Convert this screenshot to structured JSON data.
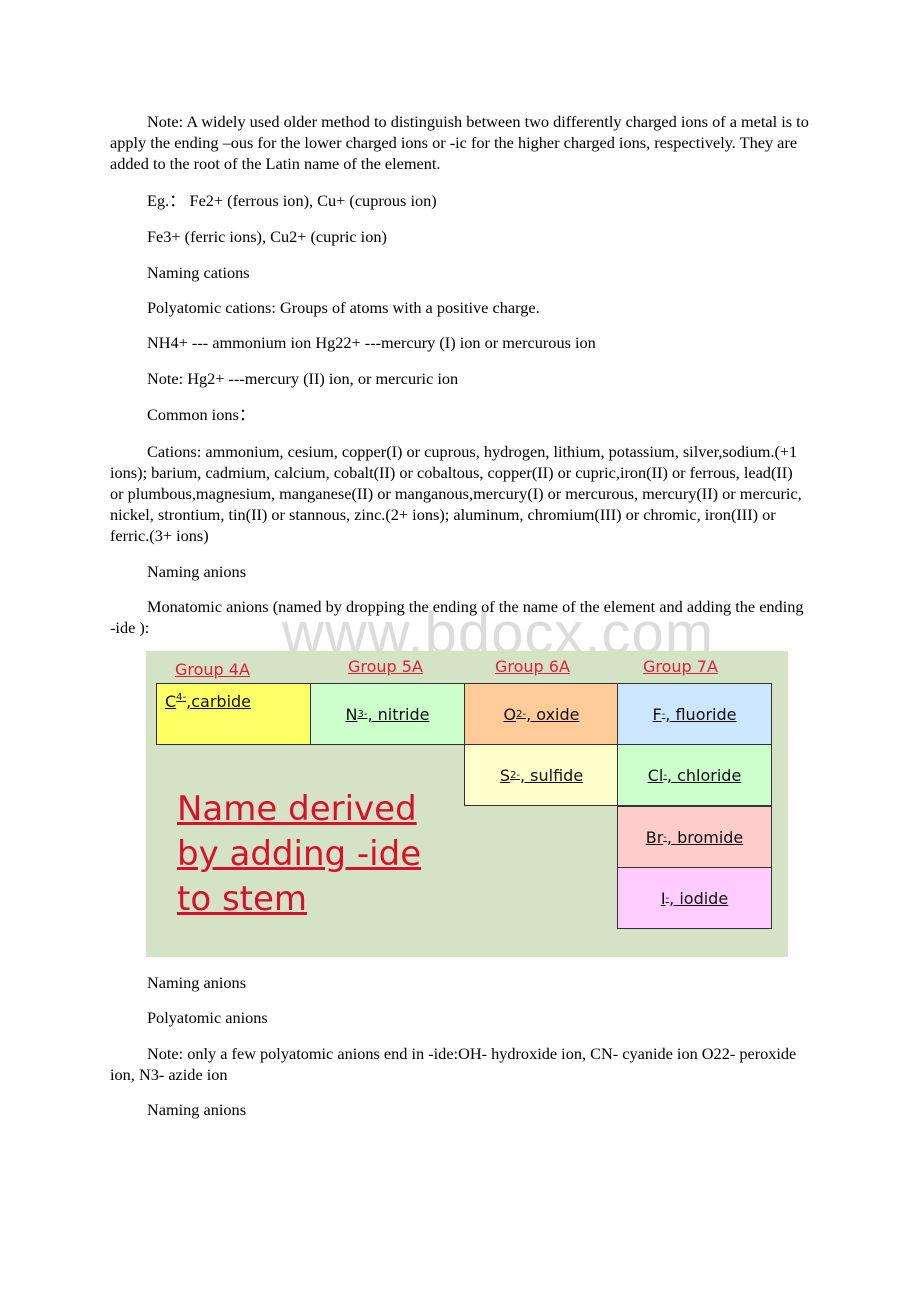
{
  "document": {
    "paragraphs": {
      "note_older_method": "Note: A widely used older method to distinguish between two differently charged ions of a metal is to apply the ending –ous for the lower charged ions or -ic for the higher charged ions, respectively. They are added to the root of the Latin name of the element.",
      "eg_line1": "Eg.： Fe2+ (ferrous ion), Cu+ (cuprous ion)",
      "eg_line2": " Fe3+ (ferric ions), Cu2+ (cupric ion)",
      "naming_cations": "Naming cations",
      "polyatomic_cations": "Polyatomic cations: Groups of atoms with a positive charge.",
      "nh4_line": "NH4+ --- ammonium ion Hg22+ ---mercury (I) ion or mercurous ion",
      "hg_note": "Note: Hg2+ ---mercury (II) ion, or mercuric ion",
      "common_ions": "Common ions：",
      "cations_list": "Cations: ammonium, cesium, copper(I) or cuprous, hydrogen, lithium, potassium, silver,sodium.(+1 ions); barium, cadmium, calcium, cobalt(II) or cobaltous, copper(II) or cupric,iron(II) or ferrous, lead(II) or plumbous,magnesium, manganese(II) or manganous,mercury(I) or mercurous, mercury(II) or mercuric, nickel, strontium, tin(II) or stannous, zinc.(2+ ions); aluminum, chromium(III) or chromic, iron(III) or ferric.(3+ ions)",
      "naming_anions_1": "Naming anions",
      "monatomic_anions": " Monatomic anions (named by dropping the ending of the name of the element and adding the ending -ide ):",
      "naming_anions_2": "Naming anions",
      "polyatomic_anions": "Polyatomic anions",
      "ide_note": "Note: only a few polyatomic anions end in -ide:OH- hydroxide ion, CN- cyanide ion O22- peroxide ion, N3- azide ion",
      "naming_anions_3": "Naming anions"
    },
    "watermark": "www.bdocx.com",
    "figure": {
      "groups": [
        "Group 4A",
        "Group 5A",
        "Group 6A",
        "Group 7A"
      ],
      "cells": [
        {
          "symbol": "C",
          "charge": "4-",
          "name": ",carbide",
          "color": "#ffff66"
        },
        {
          "symbol": "N",
          "charge": "3-",
          "name": ", nitride",
          "color": "#ccffcc"
        },
        {
          "symbol": "O",
          "charge": "2-",
          "name": ", oxide",
          "color": "#ffcc99"
        },
        {
          "symbol": "F",
          "charge": "-",
          "name": ", fluoride",
          "color": "#cce6ff"
        },
        {
          "symbol": "S",
          "charge": "2-",
          "name": ", sulfide",
          "color": "#ffffcc"
        },
        {
          "symbol": "Cl",
          "charge": "-",
          "name": ", chloride",
          "color": "#ccffcc"
        },
        {
          "symbol": "Br",
          "charge": "-",
          "name": ", bromide",
          "color": "#ffcccc"
        },
        {
          "symbol": "I",
          "charge": "-",
          "name": ", iodide",
          "color": "#ffccff"
        }
      ],
      "caption_lines": [
        "Name derived",
        "by adding -ide",
        "to stem"
      ],
      "background": "#d4e2c6",
      "accent_red": "#d8102c"
    }
  }
}
